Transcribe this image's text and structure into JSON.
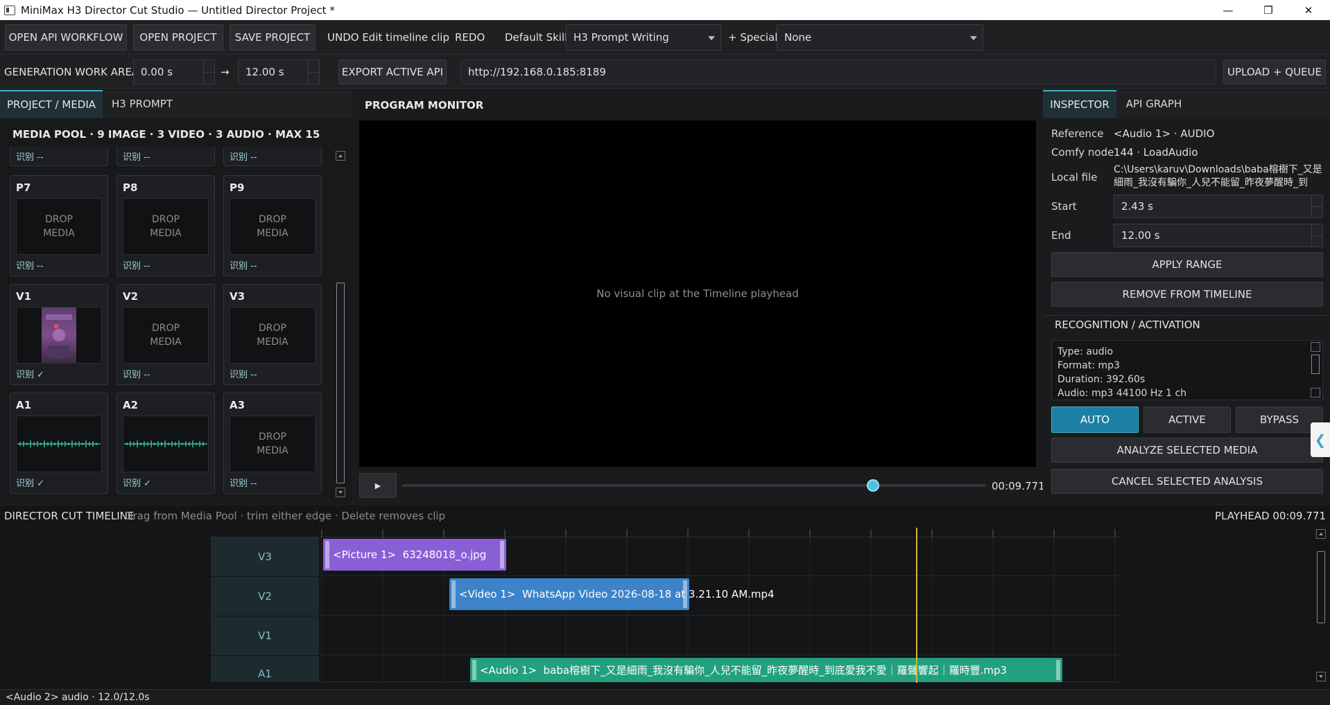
{
  "window": {
    "title": "MiniMax H3 Director Cut Studio — Untitled Director Project *",
    "minimize": "—",
    "maximize": "❐",
    "close": "✕"
  },
  "toolbar": {
    "open_api_workflow": "OPEN API WORKFLOW",
    "open_project": "OPEN PROJECT",
    "save_project": "SAVE PROJECT",
    "undo": "UNDO Edit timeline clip",
    "redo": "REDO",
    "default_skill_label": "Default Skill",
    "default_skill_value": "H3 Prompt Writing",
    "special_label": "+ Special",
    "special_value": "None"
  },
  "work_area": {
    "label": "GENERATION WORK AREA",
    "start": "0.00 s",
    "arrow": "→",
    "end": "12.00 s",
    "export_button": "EXPORT ACTIVE API",
    "url": "http://192.168.0.185:8189",
    "upload_button": "UPLOAD + QUEUE"
  },
  "left_panel": {
    "tabs": [
      "PROJECT / MEDIA",
      "H3 PROMPT"
    ],
    "pool_title": "MEDIA POOL · 9 IMAGE · 3 VIDEO · 3 AUDIO · MAX 15",
    "partial_status": [
      "识别 --",
      "识别 --",
      "识别 --"
    ],
    "drop_text": "DROP\nMEDIA",
    "cells": [
      {
        "name": "P7",
        "status": "识别 --"
      },
      {
        "name": "P8",
        "status": "识别 --"
      },
      {
        "name": "P9",
        "status": "识别 --"
      },
      {
        "name": "V1",
        "status": "识别 ✓"
      },
      {
        "name": "V2",
        "status": "识别 --"
      },
      {
        "name": "V3",
        "status": "识别 --"
      },
      {
        "name": "A1",
        "status": "识别 ✓"
      },
      {
        "name": "A2",
        "status": "识别 ✓"
      },
      {
        "name": "A3",
        "status": "识别 --"
      }
    ]
  },
  "monitor": {
    "title": "PROGRAM MONITOR",
    "empty_message": "No visual clip at the Timeline playhead",
    "play": "▶",
    "timecode": "00:09.771",
    "progress": 0.806
  },
  "inspector": {
    "tabs": [
      "INSPECTOR",
      "API GRAPH"
    ],
    "reference_label": "Reference",
    "reference_value": "<Audio 1> · AUDIO",
    "comfy_label": "Comfy node",
    "comfy_value": "144 · LoadAudio",
    "local_file_label": "Local file",
    "local_file_line1": "C:\\Users\\karuv\\Downloads\\baba榕樹下_又是",
    "local_file_line2": "細雨_我沒有騙你_人兒不能留_昨夜夢醒時_到",
    "start_label": "Start",
    "start_value": "2.43 s",
    "end_label": "End",
    "end_value": "12.00 s",
    "apply_range": "APPLY RANGE",
    "remove": "REMOVE FROM TIMELINE",
    "recognition_title": "RECOGNITION / ACTIVATION",
    "recognition_lines": [
      "Type: audio",
      "Format: mp3",
      "Duration: 392.60s",
      "Audio: mp3  44100 Hz  1 ch"
    ],
    "modes": [
      "AUTO",
      "ACTIVE",
      "BYPASS"
    ],
    "analyze": "ANALYZE SELECTED MEDIA",
    "cancel": "CANCEL SELECTED ANALYSIS",
    "collapse": "❮"
  },
  "timeline": {
    "title": "DIRECTOR CUT TIMELINE",
    "hint": "Drag from Media Pool · trim either edge · Delete removes clip",
    "playhead": "PLAYHEAD 00:09.771",
    "tracks": [
      "V3",
      "V2",
      "V1",
      "A1"
    ],
    "clips": {
      "v3": {
        "tag": "<Picture 1>",
        "name": "63248018_o.jpg"
      },
      "v2": {
        "tag": "<Video 1>",
        "name": "WhatsApp Video 2026-08-18 at 3.21.10 AM.mp4"
      },
      "a1": {
        "tag": "<Audio 1>",
        "name": "baba榕樹下_又是細雨_我沒有騙你_人兒不能留_昨夜夢醒時_到底愛我不愛｜羅聲響起｜羅時豐.mp3"
      }
    }
  },
  "statusbar": {
    "text": "<Audio 2> audio · 12.0/12.0s"
  },
  "colors": {
    "accent": "#3fb6c9",
    "picture_clip": "#8a5fd6",
    "video_clip": "#3d83c9",
    "audio_clip": "#23a07f",
    "playhead": "#d8b63a"
  }
}
